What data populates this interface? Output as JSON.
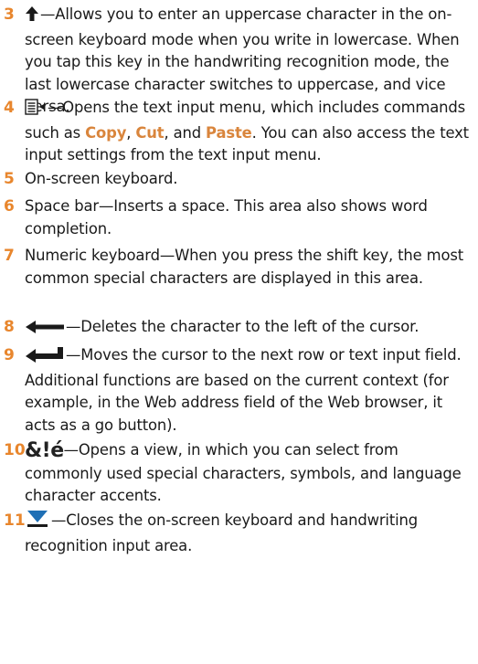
{
  "items": [
    {
      "num": "3",
      "dash": "—",
      "text": "Allows you to enter an uppercase character in the on-screen keyboard mode when you write in lowercase. When you tap this key in the handwriting recognition mode, the last lowercase character switches to uppercase, and vice versa.",
      "icon": "shift-up-arrow-icon"
    },
    {
      "num": "4",
      "dash": "—",
      "text_a": "Opens the text input menu, which includes commands such as ",
      "copy": "Copy",
      "sep1": ", ",
      "cut": "Cut",
      "sep2": ", and ",
      "paste": "Paste",
      "text_b": ". You can also access the text input settings from the text input menu.",
      "icon": "text-menu-icon"
    },
    {
      "num": "5",
      "text": "On-screen keyboard."
    },
    {
      "num": "6",
      "text": "Space bar—Inserts a space. This area also shows word completion."
    },
    {
      "num": "7",
      "text": "Numeric keyboard—When you press the shift key, the most common special characters are displayed in this area."
    },
    {
      "num": "8",
      "dash": "—",
      "text": "Deletes the character to the left of the cursor.",
      "icon": "backspace-arrow-icon"
    },
    {
      "num": "9",
      "dash": "—",
      "text": "Moves the cursor to the next row or text input field. Additional functions are based on the current context (for example, in the Web address field of the Web browser, it acts as a go button).",
      "icon": "enter-arrow-icon"
    },
    {
      "num": "10",
      "symbol": "&!é",
      "dash": "—",
      "text": "Opens a view, in which you can select from commonly used special characters, symbols, and language character accents.",
      "icon": "special-characters-icon"
    },
    {
      "num": "11",
      "dash": "—",
      "text": "Closes the on-screen keyboard and handwriting recognition input area.",
      "icon": "close-keyboard-icon"
    }
  ]
}
